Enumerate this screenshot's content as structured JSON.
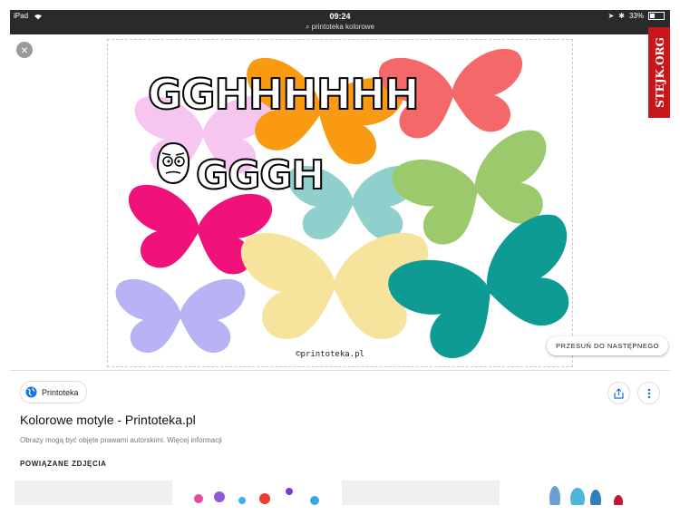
{
  "status_bar": {
    "device": "iPad",
    "time": "09:24",
    "url": "printoteka kolorowe",
    "battery": "33%",
    "battery_level": 0.33
  },
  "viewer": {
    "meme_text_1": "GGHHHHHH",
    "meme_text_2": "GGGH",
    "image_credit": "©printoteka.pl",
    "watermark": "STEJK.ORG",
    "next_button": "PRZESUŃ DO NASTĘPNEGO",
    "butterflies": [
      {
        "color": "#f7c6f0"
      },
      {
        "color": "#f99a12"
      },
      {
        "color": "#f4686a"
      },
      {
        "color": "#8fd0cc"
      },
      {
        "color": "#9cc96b"
      },
      {
        "color": "#f0127a"
      },
      {
        "color": "#f6e39c"
      },
      {
        "color": "#0e9b94"
      },
      {
        "color": "#b7b3f4"
      }
    ]
  },
  "result": {
    "source": "Printoteka",
    "title": "Kolorowe motyle - Printoteka.pl",
    "copyright": "Obrazy mogą być objęte prawami autorskimi. Więcej informacji",
    "related_heading": "POWIĄZANE ZDJĘCIA"
  },
  "icons": {
    "close": "close-icon",
    "share": "share-icon",
    "more": "more-vert-icon",
    "globe": "globe-icon"
  }
}
